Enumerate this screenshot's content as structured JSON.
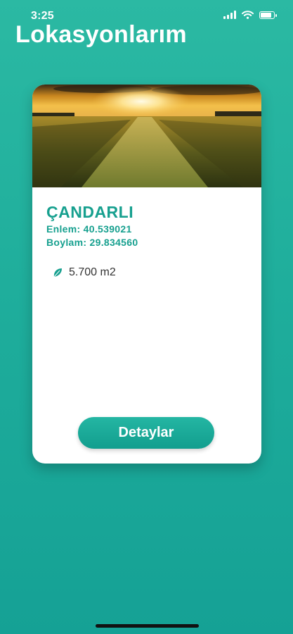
{
  "status_bar": {
    "time": "3:25",
    "icons": [
      "cellular-signal-icon",
      "wifi-icon",
      "battery-icon"
    ]
  },
  "header": {
    "title": "Lokasyonlarım"
  },
  "location_card": {
    "image": "sunset-wheat-field-image",
    "name": "ÇANDARLI",
    "latitude": "Enlem: 40.539021",
    "longitude": "Boylam: 29.834560",
    "area_icon": "leaf-icon",
    "area": "5.700 m2",
    "details_button": "Detaylar"
  },
  "colors": {
    "accent": "#17a08f",
    "background": "#1fae9c",
    "card": "#ffffff"
  }
}
